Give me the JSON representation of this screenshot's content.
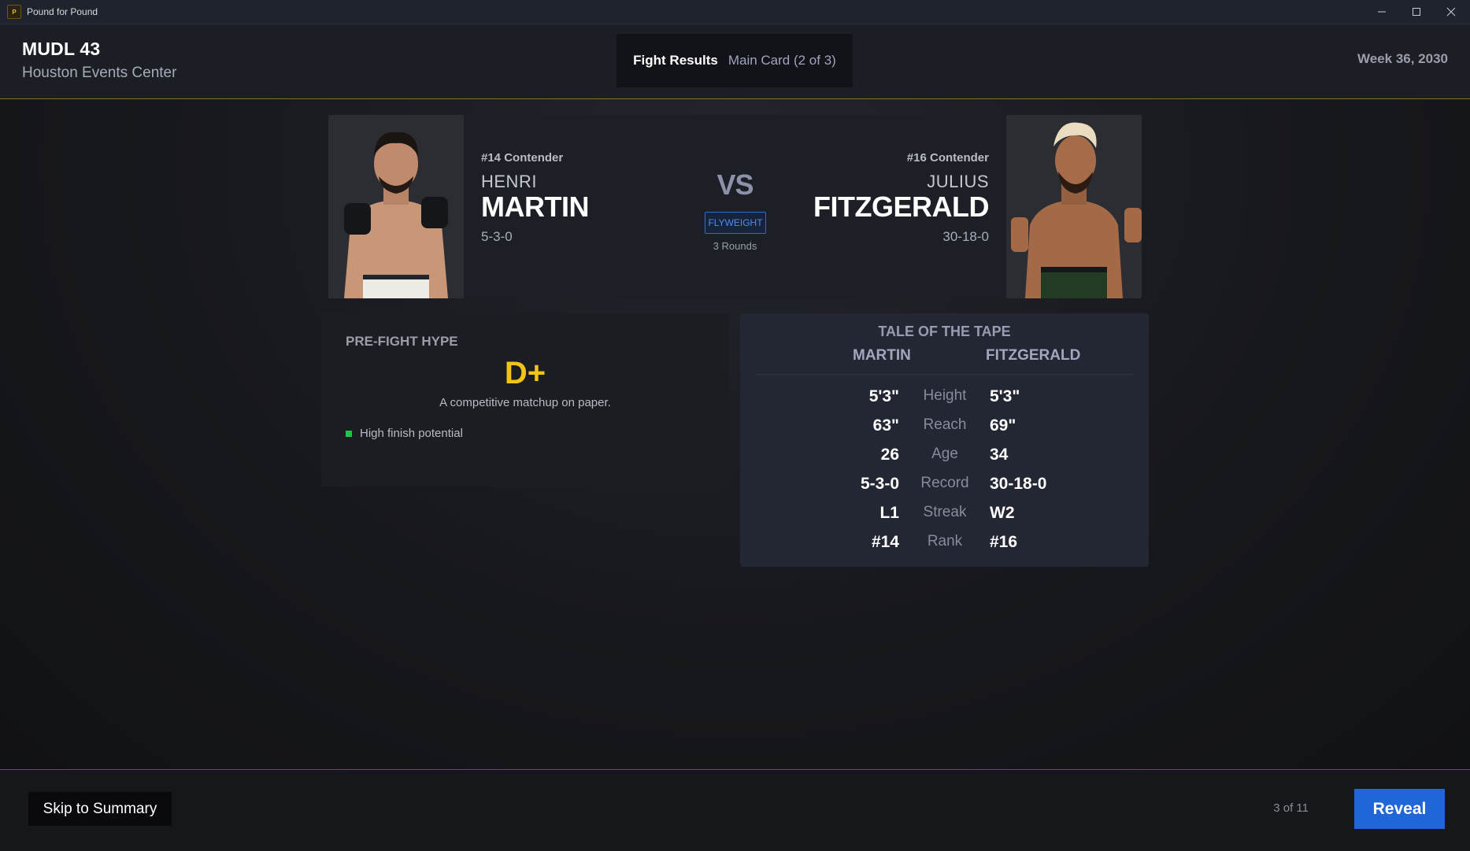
{
  "window": {
    "title": "Pound for Pound",
    "controls": [
      "minimize-icon",
      "maximize-icon",
      "close-icon"
    ]
  },
  "header": {
    "event_name": "MUDL 43",
    "venue": "Houston Events Center",
    "tab_label": "Fight Results",
    "card_label": "Main Card (2 of 3)",
    "week": "Week 36, 2030"
  },
  "matchup": {
    "left": {
      "rank": "#14 Contender",
      "first_name": "HENRI",
      "last_name": "MARTIN",
      "record": "5-3-0"
    },
    "right": {
      "rank": "#16 Contender",
      "first_name": "JULIUS",
      "last_name": "FITZGERALD",
      "record": "30-18-0"
    },
    "vs": "VS",
    "weight_class": "FLYWEIGHT",
    "rounds": "3 Rounds"
  },
  "hype": {
    "title": "PRE-FIGHT HYPE",
    "grade": "D+",
    "description": "A competitive matchup on paper.",
    "notes": [
      "High finish potential"
    ]
  },
  "tape": {
    "title": "TALE OF THE TAPE",
    "left_name": "MARTIN",
    "right_name": "FITZGERALD",
    "rows": [
      {
        "label": "Height",
        "left": "5'3\"",
        "right": "5'3\""
      },
      {
        "label": "Reach",
        "left": "63\"",
        "right": "69\""
      },
      {
        "label": "Age",
        "left": "26",
        "right": "34"
      },
      {
        "label": "Record",
        "left": "5-3-0",
        "right": "30-18-0"
      },
      {
        "label": "Streak",
        "left": "L1",
        "right": "W2"
      },
      {
        "label": "Rank",
        "left": "#14",
        "right": "#16"
      }
    ]
  },
  "footer": {
    "skip_label": "Skip to Summary",
    "counter": "3 of 11",
    "reveal_label": "Reveal"
  },
  "colors": {
    "accent_gold": "#f2c318",
    "accent_blue": "#1f66d8",
    "divider_gold": "#8a6d1e",
    "positive_green": "#25c24a"
  }
}
